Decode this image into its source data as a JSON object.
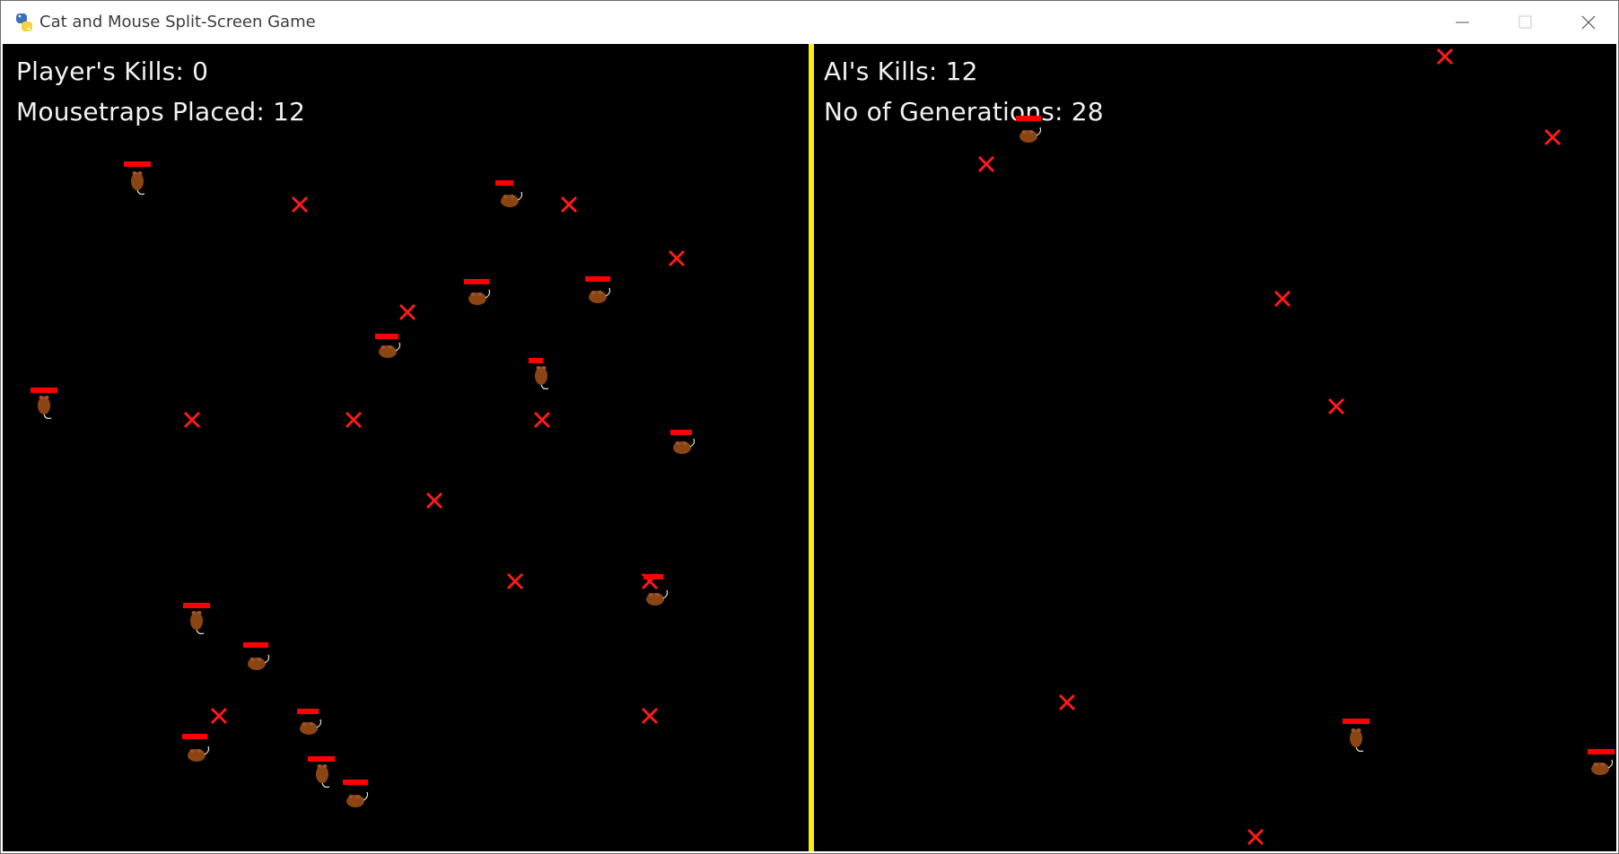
{
  "window": {
    "title": "Cat and Mouse Split-Screen Game",
    "buttons": [
      "minimize",
      "maximize",
      "close"
    ]
  },
  "left_panel": {
    "kills_label": "Player's Kills: 0",
    "traps_label": "Mousetraps Placed: 12"
  },
  "right_panel": {
    "kills_label": "AI's Kills: 12",
    "generations_label": "No of Generations: 28"
  },
  "colors": {
    "background": "#000000",
    "divider": "#f7ef12",
    "trap": "#ff1a1a",
    "health_bar": "#ff0000",
    "mouse": "#8b4513",
    "hud_text": "#f2f2f2"
  },
  "icons": {
    "trap": "red-x-icon",
    "mouse": "brown-mouse-sprite",
    "app": "python-logo-icon"
  }
}
